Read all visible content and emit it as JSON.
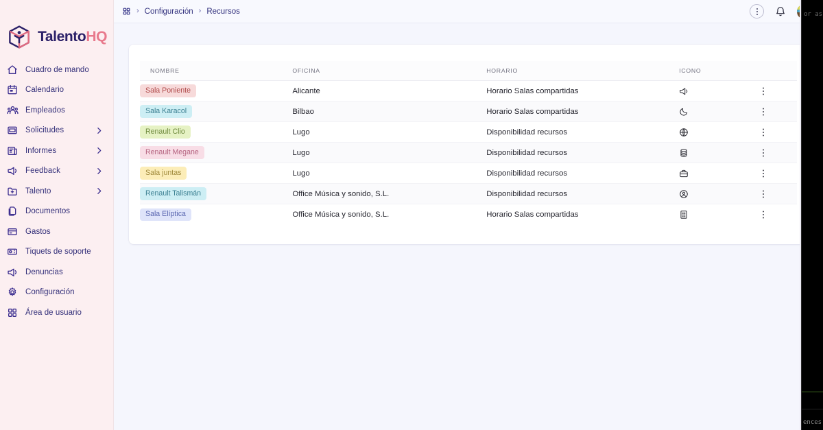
{
  "brand": {
    "name_part1": "Talento",
    "name_part2": "HQ",
    "logo_icon": "cube-person-logo"
  },
  "sidebar": {
    "items": [
      {
        "label": "Cuadro de mando",
        "icon": "home-icon",
        "chevron": false
      },
      {
        "label": "Calendario",
        "icon": "calendar-icon",
        "chevron": false
      },
      {
        "label": "Empleados",
        "icon": "users-icon",
        "chevron": false
      },
      {
        "label": "Solicitudes",
        "icon": "inbox-icon",
        "chevron": true
      },
      {
        "label": "Informes",
        "icon": "report-icon",
        "chevron": true
      },
      {
        "label": "Feedback",
        "icon": "megaphone-icon",
        "chevron": true
      },
      {
        "label": "Talento",
        "icon": "folder-plus-icon",
        "chevron": true
      },
      {
        "label": "Documentos",
        "icon": "documents-icon",
        "chevron": false
      },
      {
        "label": "Gastos",
        "icon": "card-icon",
        "chevron": false
      },
      {
        "label": "Tiquets de soporte",
        "icon": "ticket-icon",
        "chevron": false
      },
      {
        "label": "Denuncias",
        "icon": "megaphone-icon",
        "chevron": false
      },
      {
        "label": "Configuración",
        "icon": "gear-icon",
        "chevron": false
      },
      {
        "label": "Área de usuario",
        "icon": "grid-icon",
        "chevron": false
      }
    ]
  },
  "topbar": {
    "apps_icon": "grid-apps-icon",
    "breadcrumb": [
      "Configuración",
      "Recursos"
    ],
    "separator": "›",
    "more_icon": "more-options-icon",
    "notifications_icon": "bell-icon",
    "avatar_icon": "user-avatar"
  },
  "table": {
    "columns": [
      "NOMBRE",
      "OFICINA",
      "HORARIO",
      "ICONO",
      ""
    ],
    "row_menu_icon": "kebab-menu-icon",
    "rows": [
      {
        "nombre": "Sala Poniente",
        "badge_bg": "#f7dada",
        "badge_fg": "#b04a4a",
        "oficina": "Alicante",
        "horario": "Horario Salas compartidas",
        "icono": "megaphone-icon"
      },
      {
        "nombre": "Sala Karacol",
        "badge_bg": "#cdeef4",
        "badge_fg": "#3b7f91",
        "oficina": "Bilbao",
        "horario": "Horario Salas compartidas",
        "icono": "moon-icon"
      },
      {
        "nombre": "Renault Clio",
        "badge_bg": "#e6f2c4",
        "badge_fg": "#6f8a3e",
        "oficina": "Lugo",
        "horario": "Disponibilidad recursos",
        "icono": "globe-icon"
      },
      {
        "nombre": "Renault Megane",
        "badge_bg": "#f8dde6",
        "badge_fg": "#b4627f",
        "oficina": "Lugo",
        "horario": "Disponibilidad recursos",
        "icono": "database-icon"
      },
      {
        "nombre": "Sala juntas",
        "badge_bg": "#fcedb8",
        "badge_fg": "#a08a3c",
        "oficina": "Lugo",
        "horario": "Disponibilidad recursos",
        "icono": "briefcase-icon"
      },
      {
        "nombre": "Renault Talismán",
        "badge_bg": "#cdeef4",
        "badge_fg": "#3b7f91",
        "oficina": "Office Música y sonido, S.L.",
        "horario": "Disponibilidad recursos",
        "icono": "user-circle-icon"
      },
      {
        "nombre": "Sala Elíptica",
        "badge_bg": "#dfe4fa",
        "badge_fg": "#5a66b0",
        "oficina": "Office Música y sonido, S.L.",
        "horario": "Horario Salas compartidas",
        "icono": "building-icon"
      }
    ]
  },
  "right_panel": {
    "text_top": "or as",
    "text_bottom": "ences"
  },
  "colors": {
    "sidebar_bg": "#fceff1",
    "main_bg": "#f5f6fd",
    "card_bg": "#ffffff",
    "brand_primary": "#2b2068",
    "brand_accent": "#e8798c",
    "nav_text": "#34307a"
  }
}
